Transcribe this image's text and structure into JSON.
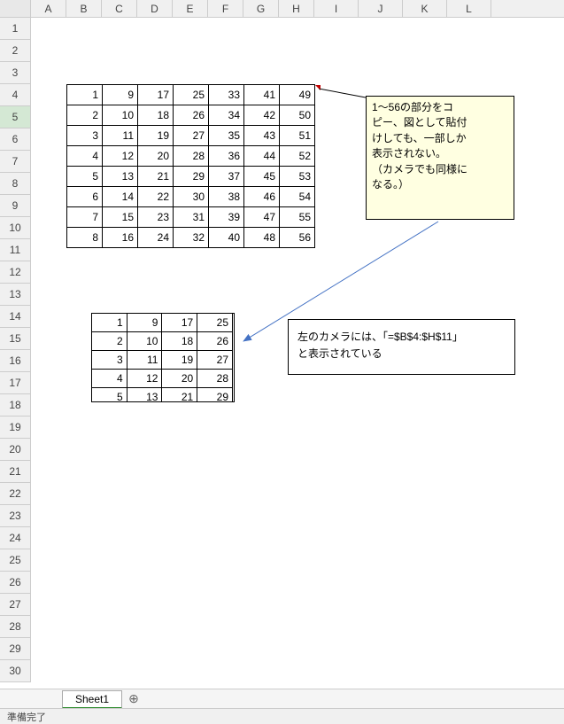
{
  "columns": [
    "A",
    "B",
    "C",
    "D",
    "E",
    "F",
    "G",
    "H",
    "I",
    "J",
    "K",
    "L"
  ],
  "row_count": 30,
  "selected_row": 5,
  "table1": [
    [
      1,
      9,
      17,
      25,
      33,
      41,
      49
    ],
    [
      2,
      10,
      18,
      26,
      34,
      42,
      50
    ],
    [
      3,
      11,
      19,
      27,
      35,
      43,
      51
    ],
    [
      4,
      12,
      20,
      28,
      36,
      44,
      52
    ],
    [
      5,
      13,
      21,
      29,
      37,
      45,
      53
    ],
    [
      6,
      14,
      22,
      30,
      38,
      46,
      54
    ],
    [
      7,
      15,
      23,
      31,
      39,
      47,
      55
    ],
    [
      8,
      16,
      24,
      32,
      40,
      48,
      56
    ]
  ],
  "table2": [
    [
      1,
      9,
      17,
      25
    ],
    [
      2,
      10,
      18,
      26
    ],
    [
      3,
      11,
      19,
      27
    ],
    [
      4,
      12,
      20,
      28
    ],
    [
      5,
      13,
      21,
      29
    ]
  ],
  "comment": {
    "line1": "1～56の部分をコ",
    "line2": "ピー、図として貼付",
    "line3": "けしても、一部しか",
    "line4": "表示されない。",
    "line5": "（カメラでも同様に",
    "line6": "なる。）"
  },
  "textbox": {
    "line1": "左のカメラには、「=$B$4:$H$11」",
    "line2": "と表示されている"
  },
  "sheet_tab": "Sheet1",
  "status": "準備完了"
}
